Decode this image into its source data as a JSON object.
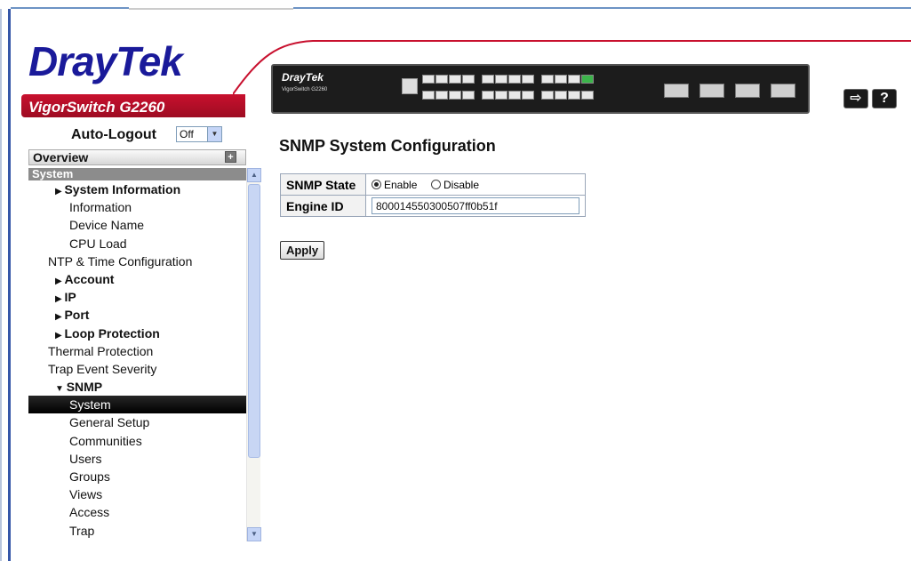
{
  "header": {
    "brand_dray": "Dray",
    "brand_tek": "Tek",
    "model": "VigorSwitch G2260",
    "device_logo": "DrayTek",
    "device_sub": "VigorSwitch G2260"
  },
  "autologout": {
    "label": "Auto-Logout",
    "value": "Off"
  },
  "nav": {
    "overview": "Overview",
    "section": "System",
    "items": [
      {
        "label": "System Information",
        "level": "l1b",
        "tri": "▶"
      },
      {
        "label": "Information",
        "level": "l2"
      },
      {
        "label": "Device Name",
        "level": "l2"
      },
      {
        "label": "CPU Load",
        "level": "l2"
      },
      {
        "label": "NTP & Time Configuration",
        "level": "l1"
      },
      {
        "label": "Account",
        "level": "l1b",
        "tri": "▶"
      },
      {
        "label": "IP",
        "level": "l1b",
        "tri": "▶"
      },
      {
        "label": "Port",
        "level": "l1b",
        "tri": "▶"
      },
      {
        "label": "Loop Protection",
        "level": "l1b",
        "tri": "▶"
      },
      {
        "label": "Thermal Protection",
        "level": "l1"
      },
      {
        "label": "Trap Event Severity",
        "level": "l1"
      },
      {
        "label": "SNMP",
        "level": "l1b",
        "tri": "▼"
      },
      {
        "label": "System",
        "level": "l2",
        "selected": true
      },
      {
        "label": "General Setup",
        "level": "l2"
      },
      {
        "label": "Communities",
        "level": "l2"
      },
      {
        "label": "Users",
        "level": "l2"
      },
      {
        "label": "Groups",
        "level": "l2"
      },
      {
        "label": "Views",
        "level": "l2"
      },
      {
        "label": "Access",
        "level": "l2"
      },
      {
        "label": "Trap",
        "level": "l2"
      }
    ]
  },
  "main": {
    "title": "SNMP System Configuration",
    "snmp_state_label": "SNMP State",
    "enable_label": "Enable",
    "disable_label": "Disable",
    "engine_id_label": "Engine ID",
    "engine_id_value": "800014550300507ff0b51f",
    "apply_label": "Apply"
  },
  "colors": {
    "brand_blue": "#1a1a9a",
    "brand_red": "#c8102e",
    "selected_bg": "#000000"
  }
}
